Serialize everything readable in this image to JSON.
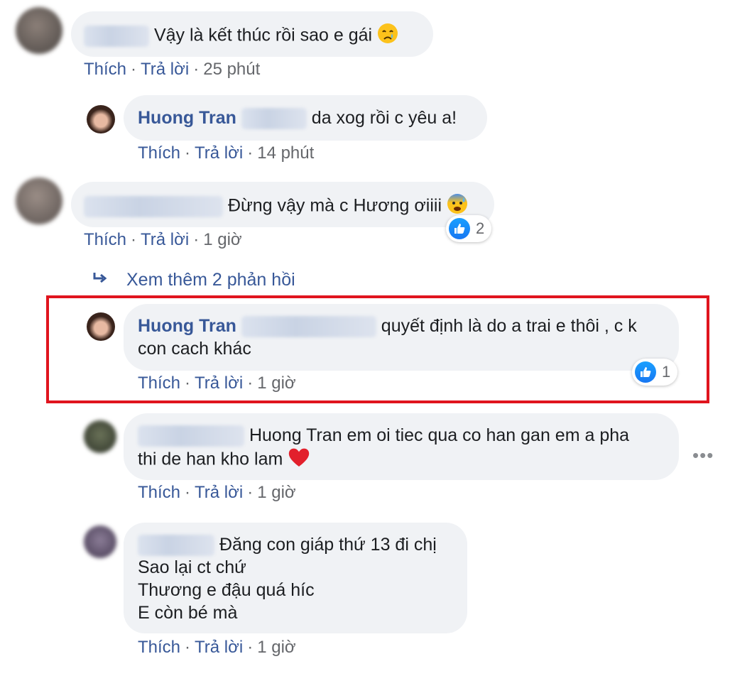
{
  "comments": [
    {
      "text": "Vậy là kết thúc rồi sao e gái",
      "actions": {
        "like": "Thích",
        "reply": "Trả lời",
        "time": "25 phút"
      }
    },
    {
      "author": "Huong Tran",
      "text": "da xog rồi c yêu a!",
      "actions": {
        "like": "Thích",
        "reply": "Trả lời",
        "time": "14 phút"
      }
    },
    {
      "text": "Đừng vậy mà c Hương ơiiii",
      "reaction_count": "2",
      "actions": {
        "like": "Thích",
        "reply": "Trả lời",
        "time": "1 giờ"
      }
    },
    {
      "author": "Huong Tran",
      "text_line1": "quyết định là do a trai e thôi , c k",
      "text_line2": "con cach khác",
      "reaction_count": "1",
      "actions": {
        "like": "Thích",
        "reply": "Trả lời",
        "time": "1 giờ"
      }
    },
    {
      "text_line1": "Huong Tran em oi tiec qua co han gan em a pha",
      "text_line2": "thi de han kho lam",
      "actions": {
        "like": "Thích",
        "reply": "Trả lời",
        "time": "1 giờ"
      }
    },
    {
      "text_lines": [
        "Đăng con giáp thứ 13 đi chị",
        "Sao lại ct chứ",
        "Thương e đậu quá híc",
        "E còn bé mà"
      ],
      "actions": {
        "like": "Thích",
        "reply": "Trả lời",
        "time": "1 giờ"
      }
    }
  ],
  "view_more_replies": "Xem thêm 2 phản hồi",
  "colors": {
    "link": "#385898",
    "bubble": "#f0f2f5",
    "highlight": "#e0141e",
    "like": "#1877f2"
  }
}
